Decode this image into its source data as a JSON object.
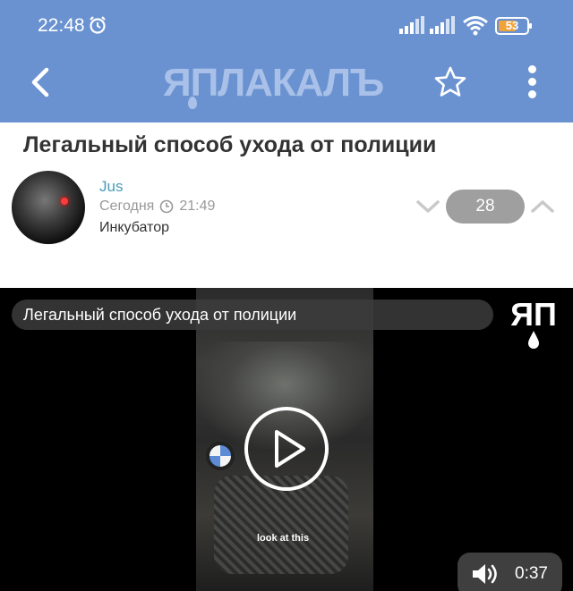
{
  "status_bar": {
    "time": "22:48",
    "battery": "53",
    "icons": [
      "alarm-icon",
      "signal-icon",
      "signal-icon",
      "wifi-icon",
      "battery-icon"
    ]
  },
  "header": {
    "logo_text": "ЯПЛАКАЛЪ",
    "icons": [
      "back-icon",
      "star-icon",
      "more-icon"
    ],
    "color": "#6a92d1"
  },
  "post": {
    "title": "Легальный способ ухода от полиции",
    "author": "Jus",
    "date": "Сегодня",
    "time": "21:49",
    "category": "Инкубатор",
    "votes": "28"
  },
  "video": {
    "title": "Легальный способ ухода от полиции",
    "watermark": "ЯП",
    "caption": "look at this",
    "duration": "0:37"
  }
}
